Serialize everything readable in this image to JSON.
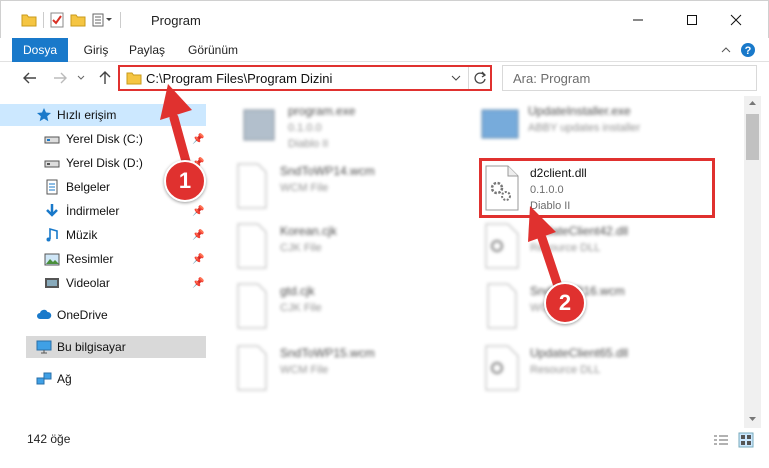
{
  "window": {
    "title": "Program"
  },
  "ribbon": {
    "tabs": [
      "Dosya",
      "Giriş",
      "Paylaş",
      "Görünüm"
    ]
  },
  "address": {
    "path": "C:\\Program Files\\Program Dizini",
    "search_placeholder": "Ara: Program"
  },
  "sidebar": {
    "quick_access": "Hızlı erişim",
    "items": [
      {
        "label": "Yerel Disk (C:)",
        "icon": "drive-icon"
      },
      {
        "label": "Yerel Disk (D:)",
        "icon": "drive-icon"
      },
      {
        "label": "Belgeler",
        "icon": "document-icon"
      },
      {
        "label": "İndirmeler",
        "icon": "download-icon"
      },
      {
        "label": "Müzik",
        "icon": "music-icon"
      },
      {
        "label": "Resimler",
        "icon": "pictures-icon"
      },
      {
        "label": "Videolar",
        "icon": "video-icon"
      }
    ],
    "onedrive": "OneDrive",
    "this_pc": "Bu bilgisayar",
    "network": "Ağ"
  },
  "files": [
    {
      "name": "program.exe",
      "line2": "0.1.0.0",
      "line3": "Diablo II"
    },
    {
      "name": "UpdateInstaller.exe",
      "line2": "ABBY updates installer",
      "line3": ""
    },
    {
      "name": "SndToWP14.wcm",
      "line2": "WCM File",
      "line3": ""
    },
    {
      "name": "d2client.dll",
      "line2": "0.1.0.0",
      "line3": "Diablo II"
    },
    {
      "name": "Korean.cjk",
      "line2": "CJK File",
      "line3": ""
    },
    {
      "name": "UpdateClient42.dll",
      "line2": "Resource DLL",
      "line3": ""
    },
    {
      "name": "gtd.cjk",
      "line2": "CJK File",
      "line3": ""
    },
    {
      "name": "SndToWP16.wcm",
      "line2": "WCM File",
      "line3": ""
    },
    {
      "name": "SndToWP15.wcm",
      "line2": "WCM File",
      "line3": ""
    },
    {
      "name": "UpdateClient65.dll",
      "line2": "Resource DLL",
      "line3": ""
    }
  ],
  "annotations": {
    "step1": "1",
    "step2": "2"
  },
  "status": {
    "count": "142 öğe"
  },
  "colors": {
    "accent": "#1979ca",
    "highlight": "#e0312f",
    "selection": "#cce8ff"
  }
}
